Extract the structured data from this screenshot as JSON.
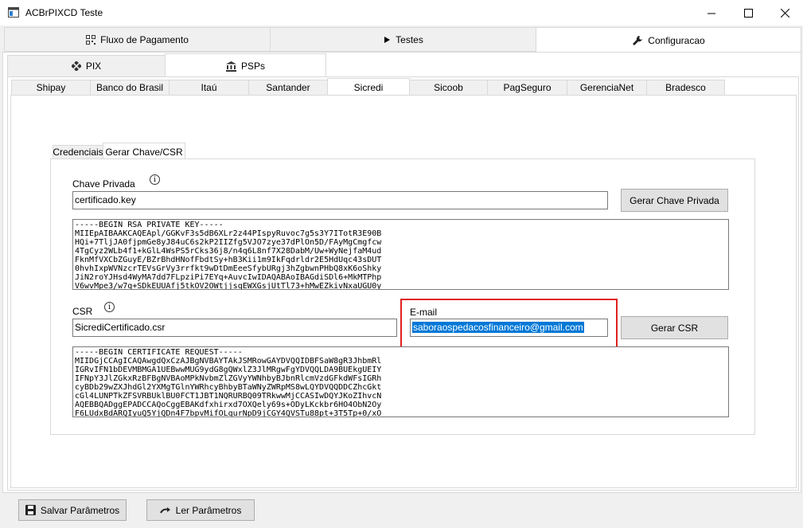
{
  "window": {
    "title": "ACBrPIXCD Teste",
    "minimize_glyph": "—",
    "maximize_glyph": "☐",
    "close_glyph": "✕",
    "icon": "app-window-icon"
  },
  "main_tabs": [
    {
      "label": "Fluxo de Pagamento",
      "icon": "qr-code-icon"
    },
    {
      "label": "Testes",
      "icon": "play-icon"
    },
    {
      "label": "Configuracao",
      "icon": "wrench-icon"
    }
  ],
  "sub_tabs": [
    {
      "label": "PIX",
      "icon": "pix-diamond-icon"
    },
    {
      "label": "PSPs",
      "icon": "bank-icon"
    }
  ],
  "banks": [
    "Shipay",
    "Banco do Brasil",
    "Itaú",
    "Santander",
    "Sicredi",
    "Sicoob",
    "PagSeguro",
    "GerenciaNet",
    "Bradesco"
  ],
  "active_bank": "Sicredi",
  "inner_tabs": [
    "Credenciais",
    "Gerar Chave/CSR"
  ],
  "chave": {
    "label": "Chave Privada",
    "value": "certificado.key",
    "button": "Gerar Chave Privada",
    "memo": "-----BEGIN RSA PRIVATE KEY-----\nMIIEpAIBAAKCAQEApl/GGKvF3s5dB6XLr2z44PIspyRuvoc7g5s3Y7ITotR3E90B\nHQi+7TljJA0fjpmGe8yJ84uC6s2kP2IIZfg5VJO7zye37dPlOn5D/FAyMgCmgfcw\n4TgCyz2WLb4f1+kGlL4WsPS5rCks36j8/n4q6L8nf7X28DabM/Uw+WyNejfaM4ud\nFknMfVXCbZGuyE/BZrBhdHNofFbdtSy+hB3Kii1m9IkFqdrldr2E5HdUqc43sDUT\n0hvhIxpWVNzcrTEVsGrVy3rrfkt9wDtDmEeeSfybURgj3hZgbwnPHbQ8xK6oShky\nJiN2roYJHsd4WyMA7dd7FLpziPi7EYq+AuvcIwIDAQABAoIBAGdiSDl6+MkMTPhp\nV6wvMpe3/w7q+SDkEUUAfj5tkOV2OWtjjsqEWXGsjUtTl73+hMwEZkivNxaUGU0y"
  },
  "csr": {
    "label": "CSR",
    "value": "SicrediCertificado.csr",
    "email_label": "E-mail",
    "email_value": "saboraospedacosfinanceiro@gmail.com",
    "button": "Gerar CSR",
    "memo": "-----BEGIN CERTIFICATE REQUEST-----\nMIIDGjCCAgICAQAwgdQxCzAJBgNVBAYTAkJSMRowGAYDVQQIDBFSaW8gR3JhbmRl\nIGRvIFN1bDEVMBMGA1UEBwwMUG9ydG8gQWxlZ3JlMRgwFgYDVQQLDA9BUEkgUEIY\nIFNpY3JlZGkxRzBFBgNVBAoMPkNvbmZlZGVyYWNhbyBJbnRlcmVzdGFkdWFsIGRh\ncyBDb29wZXJhdGl2YXMgTGlnYWRhcyBhbyBTaWNyZWRpMS8wLQYDVQQDDCZhcGkt\ncGl4LUNPTkZFSVRBUklBU0FCT1JBT1NQRURBQ09TRkwwMjCCASIwDQYJKoZIhvcN\nAQEBBQADggEPADCCAQoCggEBAKdfxhirxd7OXQely69s+ODyLKckbr6HO4ObN2Oy\nF6LUdxBdARQIyuQ5YjQDn4F7bpvMifOLqurNpD9jCGY4QVSTu88pt+3T5Tp+0/xO"
  },
  "footer": {
    "save_label": "Salvar Parâmetros",
    "load_label": "Ler Parâmetros",
    "save_icon": "floppy-disk-icon",
    "load_icon": "reload-arrow-icon"
  },
  "highlight_color": "#e0201c",
  "selection_color": "#0078d7"
}
